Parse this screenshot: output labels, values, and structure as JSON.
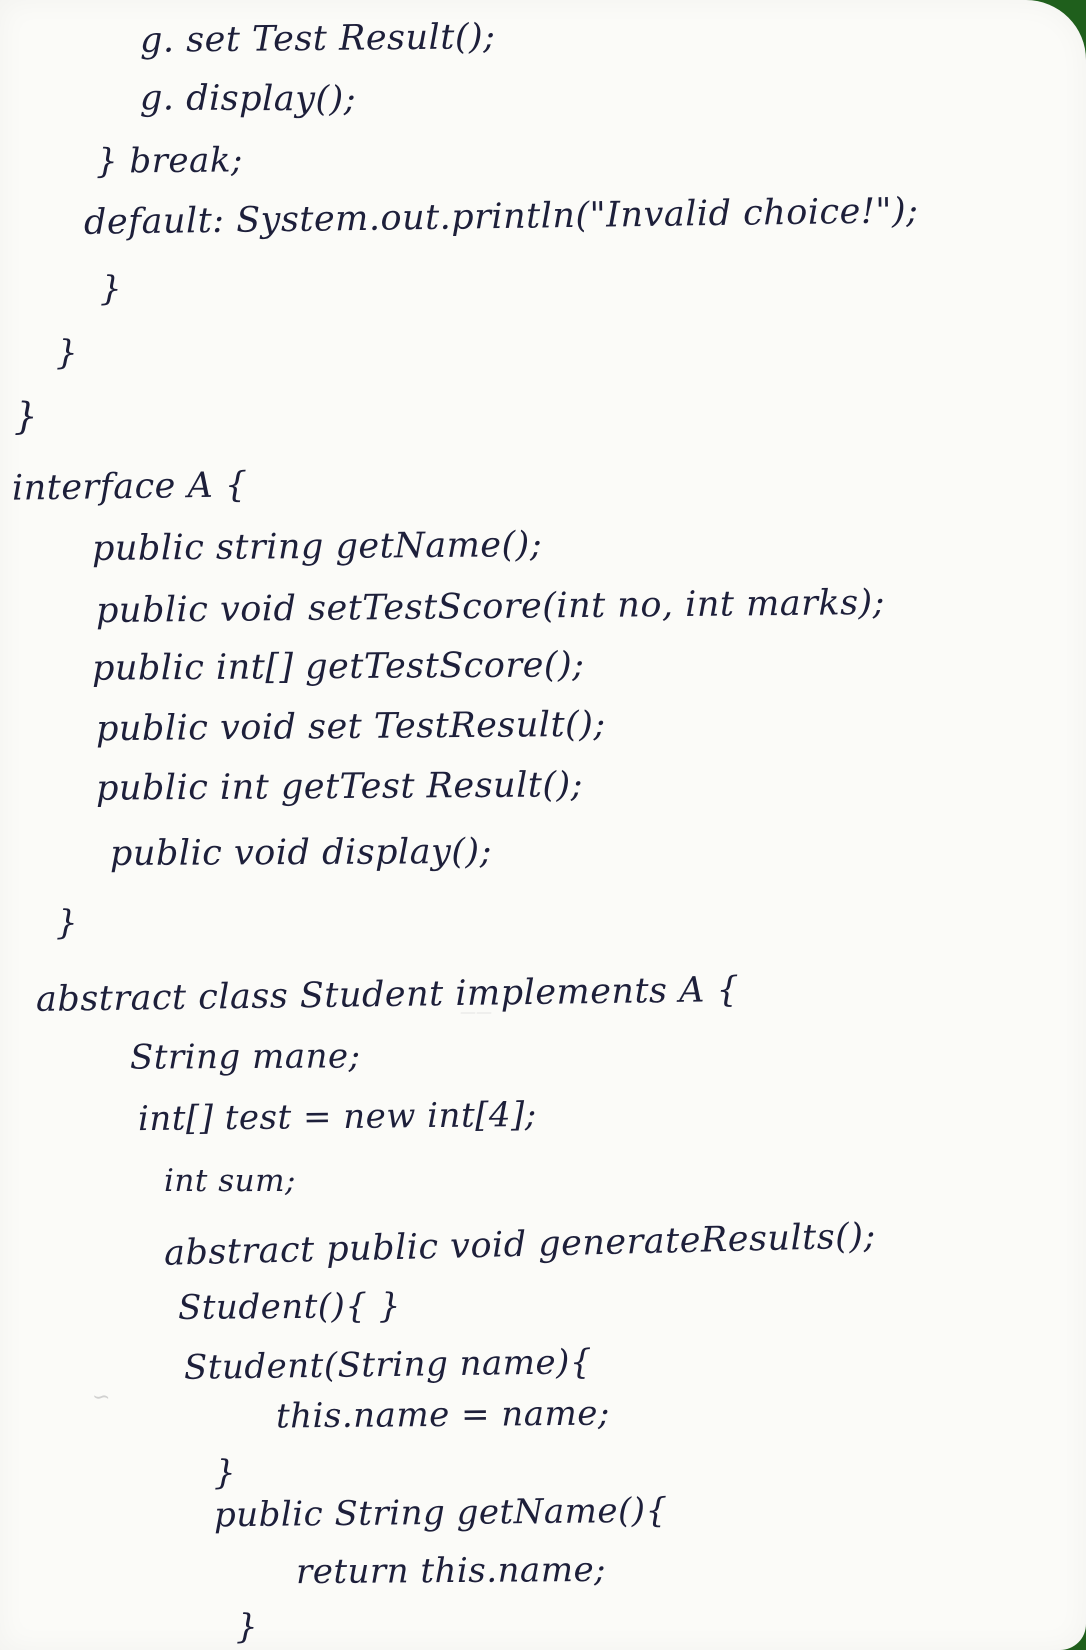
{
  "document": {
    "lines": [
      "g. set Test Result();",
      "g. display();",
      "} break;",
      "default:  System.out.println(\"Invalid choice!\");",
      "}",
      "}",
      "}",
      "interface A {",
      "public string getName();",
      "public void setTestScore(int no, int marks);",
      "public int[] getTestScore();",
      "public void set TestResult();",
      "public int getTest Result();",
      "public void display();",
      "}",
      "abstract class Student implements A {",
      "String mane;",
      "int[] test = new int[4];",
      "int sum;",
      "abstract public void generateResults();",
      "Student(){ }",
      "Student(String name){",
      "this.name = name;",
      "}",
      "public String getName(){",
      "return this.name;",
      "}"
    ]
  }
}
